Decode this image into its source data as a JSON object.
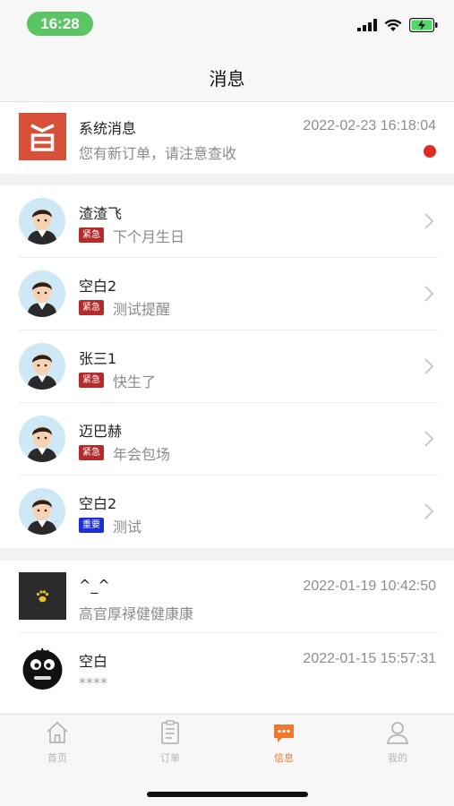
{
  "status_bar": {
    "time": "16:28"
  },
  "nav": {
    "title": "消息"
  },
  "system_message": {
    "logo_char": "旨",
    "title": "系统消息",
    "subtitle": "您有新订单，请注意查收",
    "time": "2022-02-23 16:18:04"
  },
  "reminders": [
    {
      "name": "渣渣飞",
      "tag": "紧急",
      "note": "下个月生日"
    },
    {
      "name": "空白2",
      "tag": "紧急",
      "note": "测试提醒"
    },
    {
      "name": "张三1",
      "tag": "紧急",
      "note": "快生了"
    },
    {
      "name": "迈巴赫",
      "tag": "紧急",
      "note": "年会包场"
    },
    {
      "name": "空白2",
      "tag": "重要",
      "note": "测试"
    }
  ],
  "chats": [
    {
      "name": "^_^",
      "preview": "高官厚禄健健康康",
      "time": "2022-01-19 10:42:50"
    },
    {
      "name": "空白",
      "preview": "****",
      "time": "2022-01-15 15:57:31"
    }
  ],
  "tabs": [
    {
      "label": "首页",
      "icon": "home-icon"
    },
    {
      "label": "订单",
      "icon": "order-icon"
    },
    {
      "label": "信息",
      "icon": "message-icon",
      "active": true
    },
    {
      "label": "我的",
      "icon": "profile-icon"
    }
  ],
  "colors": {
    "accent": "#f0782d",
    "urgent": "#b52a2a",
    "important": "#1d2fd6",
    "unread_dot": "#e02b25",
    "time_pill": "#5bc465"
  }
}
